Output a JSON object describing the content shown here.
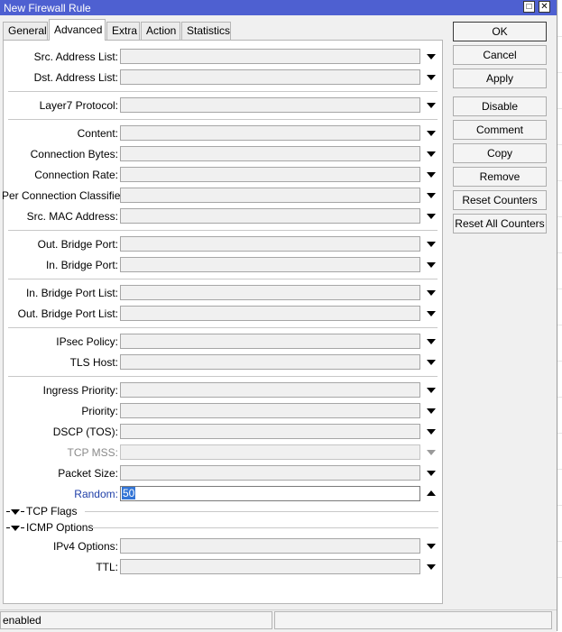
{
  "window": {
    "title": "New Firewall Rule"
  },
  "tabs": [
    {
      "label": "General",
      "active": false
    },
    {
      "label": "Advanced",
      "active": true
    },
    {
      "label": "Extra",
      "active": false
    },
    {
      "label": "Action",
      "active": false
    },
    {
      "label": "Statistics",
      "active": false
    }
  ],
  "fields": {
    "src_address_list": {
      "label": "Src. Address List:",
      "value": ""
    },
    "dst_address_list": {
      "label": "Dst. Address List:",
      "value": ""
    },
    "layer7_protocol": {
      "label": "Layer7 Protocol:",
      "value": ""
    },
    "content": {
      "label": "Content:",
      "value": ""
    },
    "connection_bytes": {
      "label": "Connection Bytes:",
      "value": ""
    },
    "connection_rate": {
      "label": "Connection Rate:",
      "value": ""
    },
    "per_connection_classifier": {
      "label": "Per Connection Classifier:",
      "value": ""
    },
    "src_mac_address": {
      "label": "Src. MAC Address:",
      "value": ""
    },
    "out_bridge_port": {
      "label": "Out. Bridge Port:",
      "value": ""
    },
    "in_bridge_port": {
      "label": "In. Bridge Port:",
      "value": ""
    },
    "in_bridge_port_list": {
      "label": "In. Bridge Port List:",
      "value": ""
    },
    "out_bridge_port_list": {
      "label": "Out. Bridge Port List:",
      "value": ""
    },
    "ipsec_policy": {
      "label": "IPsec Policy:",
      "value": ""
    },
    "tls_host": {
      "label": "TLS Host:",
      "value": ""
    },
    "ingress_priority": {
      "label": "Ingress Priority:",
      "value": ""
    },
    "priority": {
      "label": "Priority:",
      "value": ""
    },
    "dscp_tos": {
      "label": "DSCP (TOS):",
      "value": ""
    },
    "tcp_mss": {
      "label": "TCP MSS:",
      "value": ""
    },
    "packet_size": {
      "label": "Packet Size:",
      "value": ""
    },
    "random": {
      "label": "Random:",
      "value": "50"
    },
    "ipv4_options": {
      "label": "IPv4 Options:",
      "value": ""
    },
    "ttl": {
      "label": "TTL:",
      "value": ""
    }
  },
  "groups": {
    "tcp_flags": "TCP Flags",
    "icmp_options": "ICMP Options"
  },
  "buttons": {
    "ok": "OK",
    "cancel": "Cancel",
    "apply": "Apply",
    "disable": "Disable",
    "comment": "Comment",
    "copy": "Copy",
    "remove": "Remove",
    "reset_counters": "Reset Counters",
    "reset_all_counters": "Reset All Counters"
  },
  "status": {
    "state": "enabled",
    "cell2": "",
    "cell3": ""
  },
  "colors": {
    "titlebar": "#4e60d1",
    "selection": "#3375d6",
    "highlight_label": "#1f3fa8"
  }
}
